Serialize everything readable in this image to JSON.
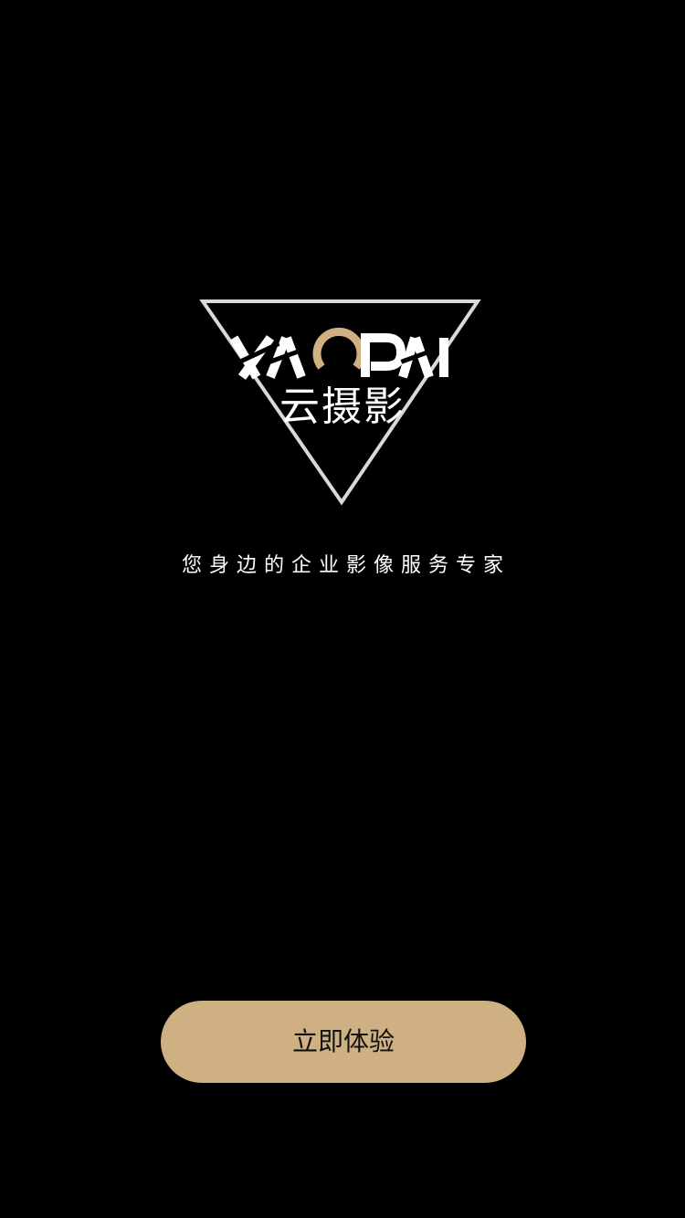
{
  "brand": {
    "logo_wordmark": "YAOPAI",
    "logo_name": "云摄影",
    "accent_color": "#ceb082",
    "outline_color": "#ffffff"
  },
  "intro": {
    "tagline": "您身边的企业影像服务专家"
  },
  "actions": {
    "start_label": "立即体验"
  }
}
